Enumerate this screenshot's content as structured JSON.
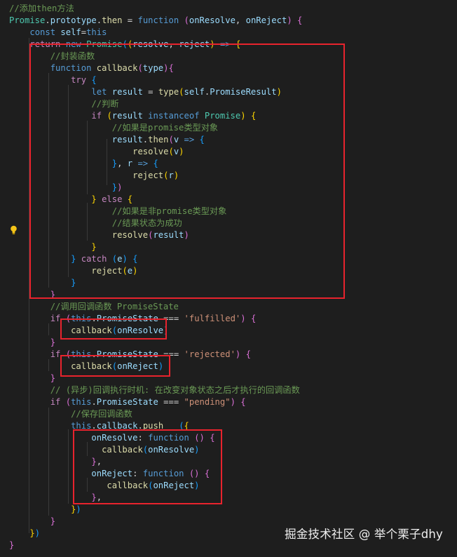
{
  "editor": {
    "theme": "dark",
    "colors": {
      "background": "#1e1e1e",
      "text": "#d4d4d4",
      "comment": "#6a9955",
      "keyword": "#569cd6",
      "control": "#c586c0",
      "function": "#dcdcaa",
      "variable": "#9cdcfe",
      "type": "#4ec9b0",
      "string": "#ce9178",
      "bracket_gold": "#ffd700",
      "bracket_pink": "#da70d6",
      "bracket_blue": "#179fff",
      "highlight_box": "#e8232d"
    },
    "lightbulb_icon": "lightbulb-icon",
    "lines": [
      [
        [
          "//添加then方法",
          "comment"
        ]
      ],
      [
        [
          "Promise",
          "type"
        ],
        [
          ".",
          ""
        ],
        [
          "prototype",
          "variable"
        ],
        [
          ".",
          ""
        ],
        [
          "then",
          "function"
        ],
        [
          " = ",
          ""
        ],
        [
          "function",
          "keyword"
        ],
        [
          " ",
          ""
        ],
        [
          "(",
          "bracket_pink"
        ],
        [
          "onResolve",
          "variable"
        ],
        [
          ", ",
          ""
        ],
        [
          "onReject",
          "variable"
        ],
        [
          ")",
          "bracket_pink"
        ],
        [
          " ",
          ""
        ],
        [
          "{",
          "bracket_pink"
        ]
      ],
      [
        [
          "    ",
          ""
        ],
        [
          "const",
          "keyword"
        ],
        [
          " ",
          ""
        ],
        [
          "self",
          "variable"
        ],
        [
          "=",
          ""
        ],
        [
          "this",
          "keyword"
        ]
      ],
      [
        [
          "    ",
          ""
        ],
        [
          "return",
          "control"
        ],
        [
          " ",
          ""
        ],
        [
          "new",
          "keyword"
        ],
        [
          " ",
          ""
        ],
        [
          "Promise",
          "type"
        ],
        [
          "(",
          "bracket_blue"
        ],
        [
          "(",
          "bracket_gold"
        ],
        [
          "resolve",
          "variable"
        ],
        [
          ", ",
          ""
        ],
        [
          "reject",
          "variable"
        ],
        [
          ")",
          "bracket_gold"
        ],
        [
          " ",
          ""
        ],
        [
          "=>",
          "keyword"
        ],
        [
          " ",
          ""
        ],
        [
          "{",
          "bracket_gold"
        ]
      ],
      [
        [
          "        ",
          ""
        ],
        [
          "//封装函数",
          "comment"
        ]
      ],
      [
        [
          "        ",
          ""
        ],
        [
          "function",
          "keyword"
        ],
        [
          " ",
          ""
        ],
        [
          "callback",
          "function"
        ],
        [
          "(",
          "bracket_pink"
        ],
        [
          "type",
          "variable"
        ],
        [
          ")",
          "bracket_pink"
        ],
        [
          "{",
          "bracket_pink"
        ]
      ],
      [
        [
          "            ",
          ""
        ],
        [
          "try",
          "control"
        ],
        [
          " ",
          ""
        ],
        [
          "{",
          "bracket_blue"
        ]
      ],
      [
        [
          "                ",
          ""
        ],
        [
          "let",
          "keyword"
        ],
        [
          " ",
          ""
        ],
        [
          "result",
          "variable"
        ],
        [
          " = ",
          ""
        ],
        [
          "type",
          "function"
        ],
        [
          "(",
          "bracket_gold"
        ],
        [
          "self",
          "variable"
        ],
        [
          ".",
          ""
        ],
        [
          "PromiseResult",
          "variable"
        ],
        [
          ")",
          "bracket_gold"
        ]
      ],
      [
        [
          "                ",
          ""
        ],
        [
          "//判断",
          "comment"
        ]
      ],
      [
        [
          "                ",
          ""
        ],
        [
          "if",
          "control"
        ],
        [
          " ",
          ""
        ],
        [
          "(",
          "bracket_gold"
        ],
        [
          "result",
          "variable"
        ],
        [
          " ",
          ""
        ],
        [
          "instanceof",
          "keyword"
        ],
        [
          " ",
          ""
        ],
        [
          "Promise",
          "type"
        ],
        [
          ")",
          "bracket_gold"
        ],
        [
          " ",
          ""
        ],
        [
          "{",
          "bracket_gold"
        ]
      ],
      [
        [
          "                    ",
          ""
        ],
        [
          "//如果是promise类型对象",
          "comment"
        ]
      ],
      [
        [
          "                    ",
          ""
        ],
        [
          "result",
          "variable"
        ],
        [
          ".",
          ""
        ],
        [
          "then",
          "function"
        ],
        [
          "(",
          "bracket_pink"
        ],
        [
          "v",
          "variable"
        ],
        [
          " ",
          ""
        ],
        [
          "=>",
          "keyword"
        ],
        [
          " ",
          ""
        ],
        [
          "{",
          "bracket_blue"
        ]
      ],
      [
        [
          "                        ",
          ""
        ],
        [
          "resolve",
          "function"
        ],
        [
          "(",
          "bracket_gold"
        ],
        [
          "v",
          "variable"
        ],
        [
          ")",
          "bracket_gold"
        ]
      ],
      [
        [
          "                    ",
          ""
        ],
        [
          "}",
          "bracket_blue"
        ],
        [
          ", ",
          ""
        ],
        [
          "r",
          "variable"
        ],
        [
          " ",
          ""
        ],
        [
          "=>",
          "keyword"
        ],
        [
          " ",
          ""
        ],
        [
          "{",
          "bracket_blue"
        ]
      ],
      [
        [
          "                        ",
          ""
        ],
        [
          "reject",
          "function"
        ],
        [
          "(",
          "bracket_gold"
        ],
        [
          "r",
          "variable"
        ],
        [
          ")",
          "bracket_gold"
        ]
      ],
      [
        [
          "                    ",
          ""
        ],
        [
          "}",
          "bracket_blue"
        ],
        [
          ")",
          "bracket_pink"
        ]
      ],
      [
        [
          "                ",
          ""
        ],
        [
          "}",
          "bracket_gold"
        ],
        [
          " ",
          ""
        ],
        [
          "else",
          "control"
        ],
        [
          " ",
          ""
        ],
        [
          "{",
          "bracket_gold"
        ]
      ],
      [
        [
          "                    ",
          ""
        ],
        [
          "//如果是非promise类型对象",
          "comment"
        ]
      ],
      [
        [
          "                    ",
          ""
        ],
        [
          "//结果状态为成功",
          "comment"
        ]
      ],
      [
        [
          "                    ",
          ""
        ],
        [
          "resolve",
          "function"
        ],
        [
          "(",
          "bracket_pink"
        ],
        [
          "result",
          "variable"
        ],
        [
          ")",
          "bracket_pink"
        ]
      ],
      [
        [
          "                ",
          ""
        ],
        [
          "}",
          "bracket_gold"
        ]
      ],
      [
        [
          "            ",
          ""
        ],
        [
          "}",
          "bracket_blue"
        ],
        [
          " ",
          ""
        ],
        [
          "catch",
          "control"
        ],
        [
          " ",
          ""
        ],
        [
          "(",
          "bracket_blue"
        ],
        [
          "e",
          "variable"
        ],
        [
          ")",
          "bracket_blue"
        ],
        [
          " ",
          ""
        ],
        [
          "{",
          "bracket_blue"
        ]
      ],
      [
        [
          "                ",
          ""
        ],
        [
          "reject",
          "function"
        ],
        [
          "(",
          "bracket_gold"
        ],
        [
          "e",
          "variable"
        ],
        [
          ")",
          "bracket_gold"
        ]
      ],
      [
        [
          "            ",
          ""
        ],
        [
          "}",
          "bracket_blue"
        ]
      ],
      [
        [
          "        ",
          ""
        ],
        [
          "}",
          "bracket_pink"
        ]
      ],
      [
        [
          "        ",
          ""
        ],
        [
          "//调用回调函数 PromiseState",
          "comment"
        ]
      ],
      [
        [
          "        ",
          ""
        ],
        [
          "if",
          "control"
        ],
        [
          " ",
          ""
        ],
        [
          "(",
          "bracket_pink"
        ],
        [
          "this",
          "keyword"
        ],
        [
          ".",
          ""
        ],
        [
          "PromiseState",
          "variable"
        ],
        [
          " === ",
          ""
        ],
        [
          "'fulfilled'",
          "string"
        ],
        [
          ")",
          "bracket_pink"
        ],
        [
          " ",
          ""
        ],
        [
          "{",
          "bracket_pink"
        ]
      ],
      [
        [
          "            ",
          ""
        ],
        [
          "callback",
          "function"
        ],
        [
          "(",
          "bracket_blue"
        ],
        [
          "onResolve",
          "variable"
        ],
        [
          ")",
          "bracket_blue"
        ]
      ],
      [
        [
          "        ",
          ""
        ],
        [
          "}",
          "bracket_pink"
        ]
      ],
      [
        [
          "        ",
          ""
        ],
        [
          "if",
          "control"
        ],
        [
          " ",
          ""
        ],
        [
          "(",
          "bracket_pink"
        ],
        [
          "this",
          "keyword"
        ],
        [
          ".",
          ""
        ],
        [
          "PromiseState",
          "variable"
        ],
        [
          " === ",
          ""
        ],
        [
          "'rejected'",
          "string"
        ],
        [
          ")",
          "bracket_pink"
        ],
        [
          " ",
          ""
        ],
        [
          "{",
          "bracket_pink"
        ]
      ],
      [
        [
          "            ",
          ""
        ],
        [
          "callback",
          "function"
        ],
        [
          "(",
          "bracket_blue"
        ],
        [
          "onReject",
          "variable"
        ],
        [
          ")",
          "bracket_blue"
        ]
      ],
      [
        [
          "        ",
          ""
        ],
        [
          "}",
          "bracket_pink"
        ]
      ],
      [
        [
          "        ",
          ""
        ],
        [
          "// (异步)回调执行时机: 在改变对象状态之后才执行的回调函数",
          "comment"
        ]
      ],
      [
        [
          "        ",
          ""
        ],
        [
          "if",
          "control"
        ],
        [
          " ",
          ""
        ],
        [
          "(",
          "bracket_pink"
        ],
        [
          "this",
          "keyword"
        ],
        [
          ".",
          ""
        ],
        [
          "PromiseState",
          "variable"
        ],
        [
          " === ",
          ""
        ],
        [
          "\"pending\"",
          "string"
        ],
        [
          ")",
          "bracket_pink"
        ],
        [
          " ",
          ""
        ],
        [
          "{",
          "bracket_pink"
        ]
      ],
      [
        [
          "            ",
          ""
        ],
        [
          "//保存回调函数",
          "comment"
        ]
      ],
      [
        [
          "            ",
          ""
        ],
        [
          "this",
          "keyword"
        ],
        [
          ".",
          ""
        ],
        [
          "callback",
          "variable"
        ],
        [
          ".",
          ""
        ],
        [
          "push",
          "function"
        ],
        [
          "   ",
          ""
        ],
        [
          "(",
          "bracket_blue"
        ],
        [
          "{",
          "bracket_gold"
        ]
      ],
      [
        [
          "                ",
          ""
        ],
        [
          "onResolve",
          "variable"
        ],
        [
          ": ",
          ""
        ],
        [
          "function",
          "keyword"
        ],
        [
          " ",
          ""
        ],
        [
          "()",
          "bracket_pink"
        ],
        [
          " ",
          ""
        ],
        [
          "{",
          "bracket_pink"
        ]
      ],
      [
        [
          "                  ",
          ""
        ],
        [
          "callback",
          "function"
        ],
        [
          "(",
          "bracket_blue"
        ],
        [
          "onResolve",
          "variable"
        ],
        [
          ")",
          "bracket_blue"
        ]
      ],
      [
        [
          "                ",
          ""
        ],
        [
          "}",
          "bracket_pink"
        ],
        [
          ",",
          ""
        ]
      ],
      [
        [
          "                ",
          ""
        ],
        [
          "onReject",
          "variable"
        ],
        [
          ": ",
          ""
        ],
        [
          "function",
          "keyword"
        ],
        [
          " ",
          ""
        ],
        [
          "()",
          "bracket_pink"
        ],
        [
          " ",
          ""
        ],
        [
          "{",
          "bracket_pink"
        ]
      ],
      [
        [
          "                   ",
          ""
        ],
        [
          "callback",
          "function"
        ],
        [
          "(",
          "bracket_blue"
        ],
        [
          "onReject",
          "variable"
        ],
        [
          ")",
          "bracket_blue"
        ]
      ],
      [
        [
          "                ",
          ""
        ],
        [
          "}",
          "bracket_pink"
        ],
        [
          ",",
          ""
        ]
      ],
      [
        [
          "            ",
          ""
        ],
        [
          "}",
          "bracket_gold"
        ],
        [
          ")",
          "bracket_blue"
        ]
      ],
      [
        [
          "        ",
          ""
        ],
        [
          "}",
          "bracket_pink"
        ]
      ],
      [
        [
          "    ",
          ""
        ],
        [
          "}",
          "bracket_gold"
        ],
        [
          ")",
          "bracket_blue"
        ]
      ],
      [
        [
          "}",
          "bracket_pink"
        ]
      ]
    ]
  },
  "watermark": {
    "text": "掘金技术社区 @ 举个栗子dhy"
  }
}
